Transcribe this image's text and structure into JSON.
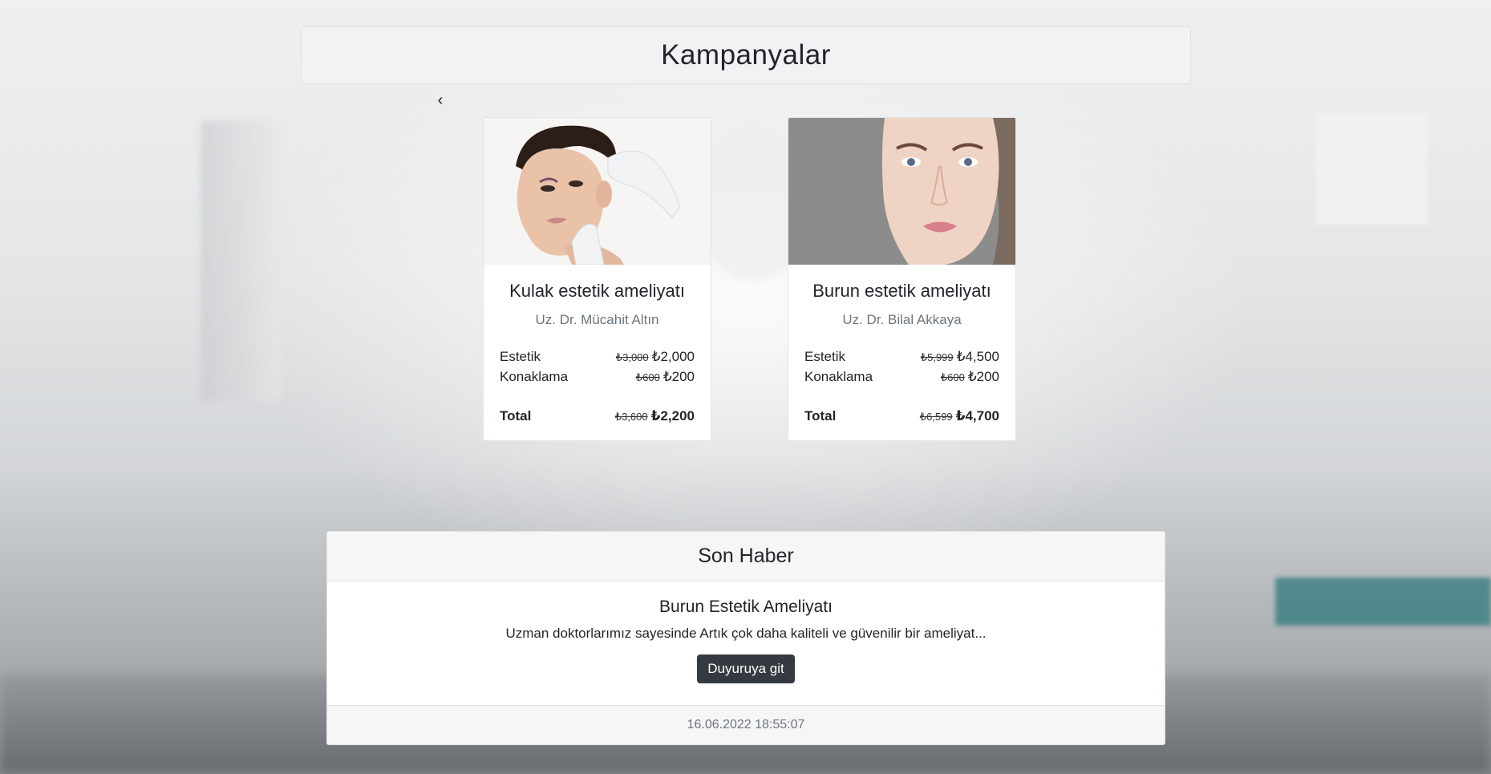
{
  "header": {
    "title": "Kampanyalar"
  },
  "carousel": {
    "prev_label": "‹"
  },
  "campaigns": [
    {
      "title": "Kulak estetik ameliyatı",
      "doctor": "Uz. Dr. Mücahit Altın",
      "rows": [
        {
          "label": "Estetik",
          "old": "₺3,000",
          "new": "₺2,000"
        },
        {
          "label": "Konaklama",
          "old": "₺600",
          "new": "₺200"
        }
      ],
      "total": {
        "label": "Total",
        "old": "₺3,600",
        "new": "₺2,200"
      }
    },
    {
      "title": "Burun estetik ameliyatı",
      "doctor": "Uz. Dr. Bilal Akkaya",
      "rows": [
        {
          "label": "Estetik",
          "old": "₺5,999",
          "new": "₺4,500"
        },
        {
          "label": "Konaklama",
          "old": "₺600",
          "new": "₺200"
        }
      ],
      "total": {
        "label": "Total",
        "old": "₺6,599",
        "new": "₺4,700"
      }
    }
  ],
  "news": {
    "header": "Son Haber",
    "title": "Burun Estetik Ameliyatı",
    "text": "Uzman doktorlarımız sayesinde Artık çok daha kaliteli ve güvenilir bir ameliyat...",
    "button_label": "Duyuruya git",
    "timestamp": "16.06.2022 18:55:07"
  }
}
